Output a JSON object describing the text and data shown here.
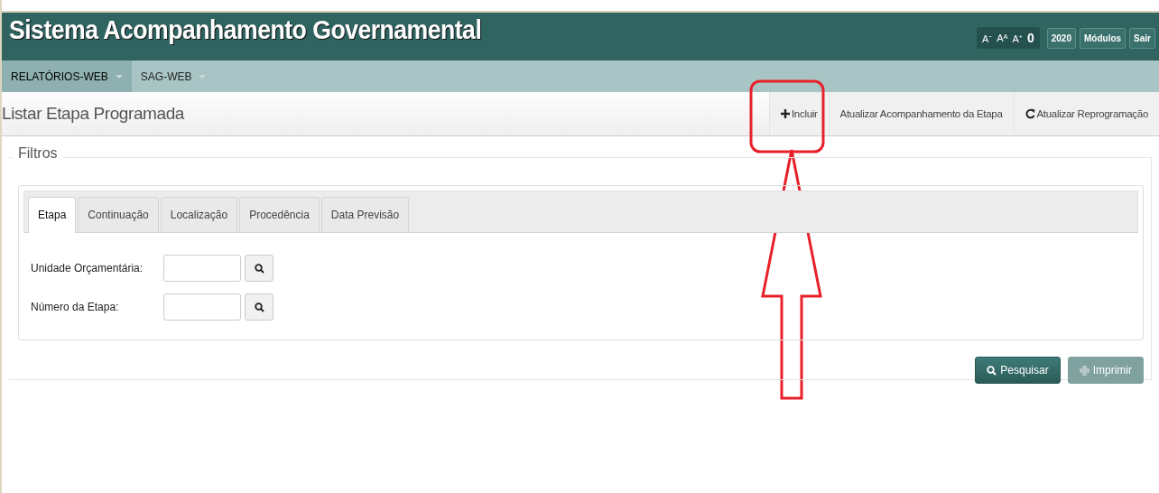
{
  "header": {
    "title": "Sistema Acompanhamento Governamental",
    "font_controls": [
      "A⁻",
      "Aᴬ",
      "A⁺",
      "0"
    ],
    "buttons": [
      "2020",
      "Módulos",
      "Sair"
    ]
  },
  "nav": [
    {
      "label": "RELATÓRIOS-WEB",
      "selected": true
    },
    {
      "label": "SAG-WEB",
      "selected": false
    }
  ],
  "page": {
    "title": "Listar Etapa Programada",
    "actions": [
      {
        "label": "Incluir",
        "kind": "add"
      },
      {
        "label": "Atualizar Acompanhamento da Etapa",
        "kind": "text"
      },
      {
        "label": "Atualizar Reprogramação",
        "kind": "reload"
      }
    ]
  },
  "filters": {
    "legend": "Filtros",
    "tabs": [
      {
        "label": "Etapa",
        "selected": true
      },
      {
        "label": "Continuação",
        "selected": false
      },
      {
        "label": "Localização",
        "selected": false
      },
      {
        "label": "Procedência",
        "selected": false
      },
      {
        "label": "Data Previsão",
        "selected": false
      }
    ],
    "fields": [
      {
        "label": "Unidade Orçamentária:"
      },
      {
        "label": "Número da Etapa:"
      }
    ],
    "buttons": [
      {
        "label": "Pesquisar",
        "kind": "search",
        "disabled": false
      },
      {
        "label": "Imprimir",
        "kind": "print",
        "disabled": true
      }
    ]
  }
}
